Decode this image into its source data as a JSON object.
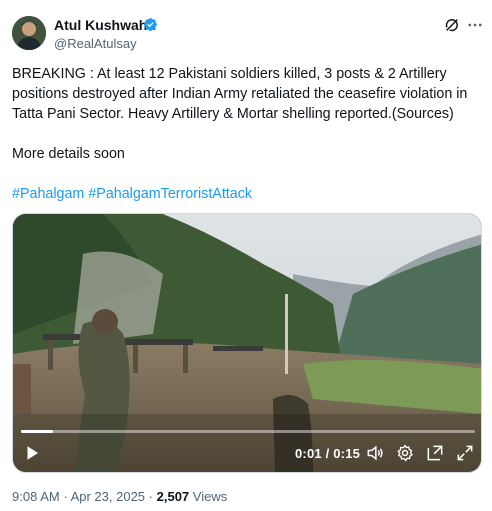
{
  "author": {
    "name": "Atul Kushwaha",
    "handle": "@RealAtulsay",
    "verified": true,
    "verified_color": "#1d9bf0"
  },
  "tweet": {
    "text": "BREAKING : At least 12 Pakistani soldiers killed, 3 posts & 2 Artillery positions destroyed after Indian Army retaliated the ceasefire violation in Tatta Pani Sector. Heavy Artillery & Mortar shelling reported.(Sources)",
    "followup": "More details soon",
    "hashtags": [
      "#Pahalgam",
      "#PahalgamTerroristAttack"
    ],
    "link_color": "#1d9bf0"
  },
  "video": {
    "time_display": "0:01 / 0:15",
    "progress": 0.07,
    "icons": [
      "play-icon",
      "volume-icon",
      "settings-icon",
      "pip-icon",
      "fullscreen-icon"
    ]
  },
  "meta": {
    "time": "9:08 AM",
    "separator": "·",
    "date": "Apr 23, 2025",
    "views_count": "2,507",
    "views_label": "Views"
  },
  "header_icons": [
    "grok-icon",
    "more-icon"
  ]
}
